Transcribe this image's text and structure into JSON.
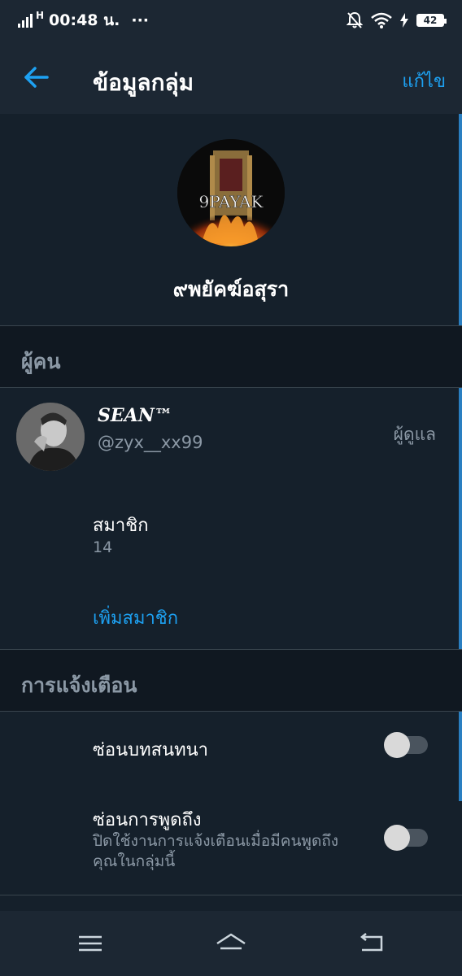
{
  "status_bar": {
    "network": "H",
    "time": "00:48 น.",
    "more": "···",
    "battery": "42"
  },
  "header": {
    "title": "ข้อมูลกลุ่ม",
    "edit_label": "แก้ไข"
  },
  "group": {
    "avatar_text": "9PAYAK",
    "name": "๙พยัคฆ์อสุรา"
  },
  "people_section": {
    "title": "ผู้คน",
    "member": {
      "name": "SEAN™",
      "handle": "@zyx__xx99",
      "role": "ผู้ดูแล"
    },
    "members_label": "สมาชิก",
    "members_count": "14",
    "add_member_label": "เพิ่มสมาชิก"
  },
  "notifications_section": {
    "title": "การแจ้งเตือน",
    "settings": [
      {
        "label": "ซ่อนบทสนทนา",
        "enabled": false
      },
      {
        "label": "ซ่อนการพูดถึง",
        "description": "ปิดใช้งานการแจ้งเตือนเมื่อมีคนพูดถึงคุณในกลุ่มนี้",
        "enabled": false
      }
    ]
  },
  "colors": {
    "background": "#15202b",
    "accent": "#1da1f2",
    "secondary_text": "#8b98a5"
  }
}
